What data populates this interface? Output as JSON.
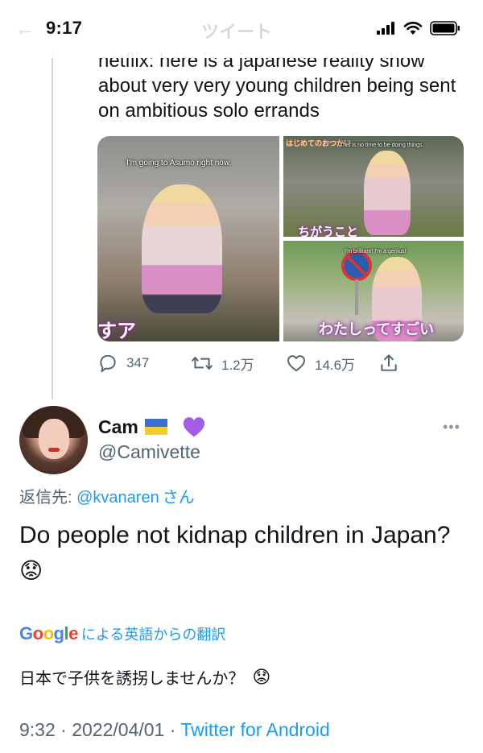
{
  "status_bar": {
    "time": "9:17",
    "ghost_back": "←",
    "ghost_title": "ツイート"
  },
  "quoted_tweet": {
    "text": "netflix: here is a japanese reality show about very very young children being sent on ambitious solo errands",
    "media": {
      "main_subtitle": "I'm going to Asumo right now.",
      "main_caption": "すア",
      "top_right_subtitle": "This is no time to be doing things.",
      "top_right_caption": "ちがうこと",
      "top_right_logo": "はじめてのおつかい",
      "bottom_right_subtitle": "I'm brilliant! I'm a genius!",
      "bottom_right_caption": "わたしってすごい"
    },
    "actions": {
      "reply_count": "347",
      "retweet_count": "1.2万",
      "like_count": "14.6万",
      "reply_icon": "reply-icon",
      "retweet_icon": "retweet-icon",
      "like_icon": "heart-icon",
      "share_icon": "share-icon"
    }
  },
  "reply_tweet": {
    "display_name": "Cam",
    "name_emojis": [
      "ukraine-flag",
      "purple-heart"
    ],
    "handle": "@Camivette",
    "more": "•••",
    "reply_to_prefix": "返信先: ",
    "reply_to_mention": "@kvanaren",
    "reply_to_suffix": "さん",
    "text": "Do people not kidnap children in Japan?",
    "text_emoji": "😟",
    "translation": {
      "google_letters": [
        "G",
        "o",
        "o",
        "g",
        "l",
        "e"
      ],
      "label": "による英語からの翻訳",
      "text": "日本で子供を誘拐しませんか？",
      "emoji": "😟"
    },
    "time": "9:32",
    "separator": "·",
    "date": "2022/04/01",
    "source": "Twitter for Android"
  },
  "colors": {
    "link": "#1d9bf0",
    "muted": "#536471",
    "text": "#0f1419",
    "thread_line": "#cfd9de",
    "google": [
      "#4285F4",
      "#EA4335",
      "#FBBC05",
      "#4285F4",
      "#34A853",
      "#EA4335"
    ]
  }
}
